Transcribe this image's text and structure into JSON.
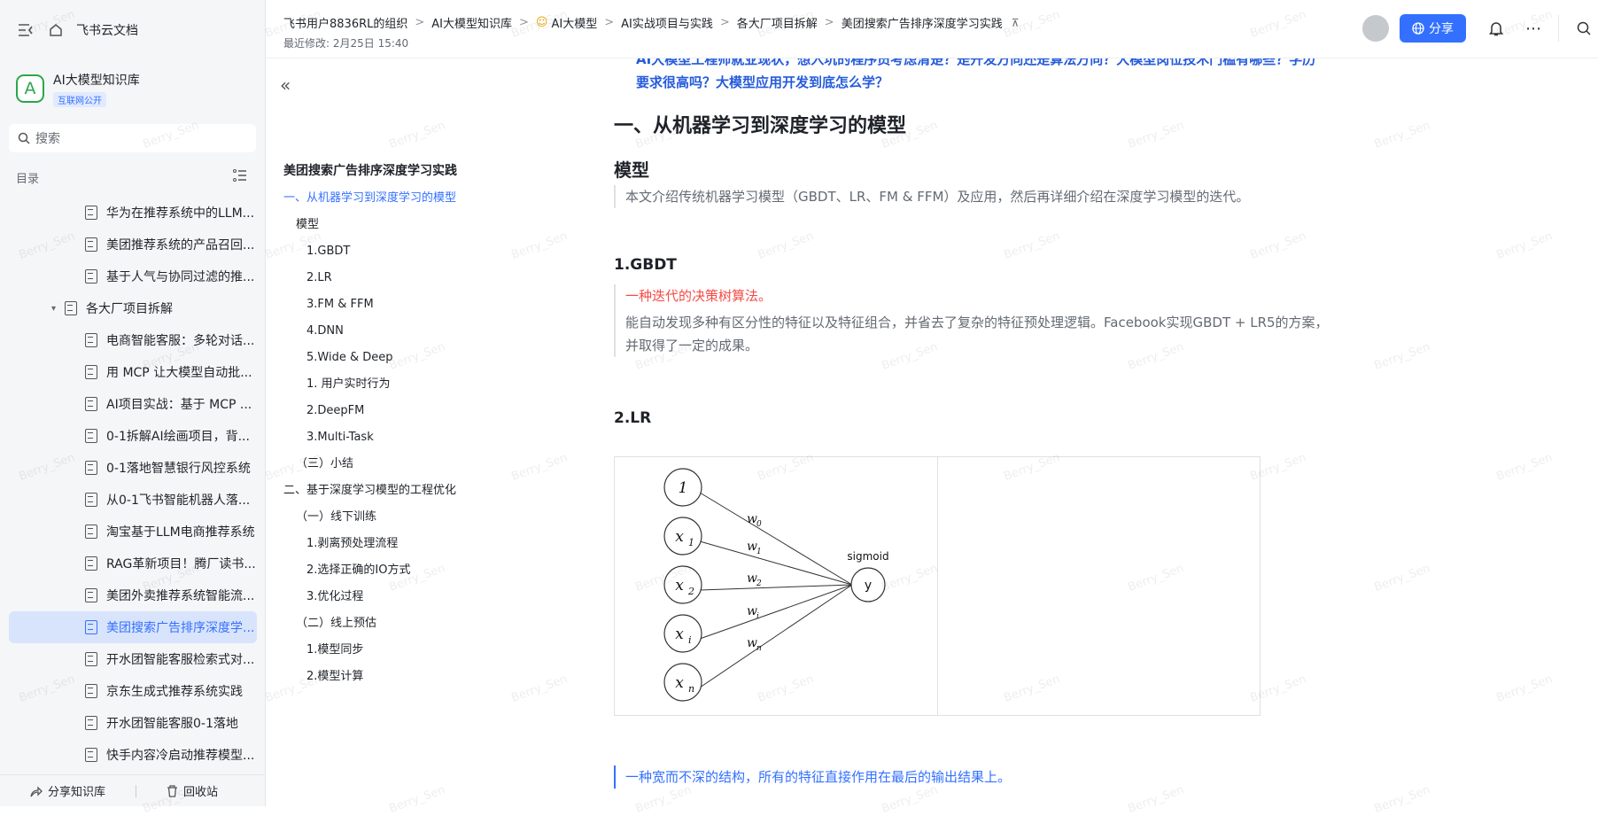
{
  "app": {
    "brand": "飞书云文档"
  },
  "knowledge_base": {
    "logo_letter": "A",
    "name": "AI大模型知识库",
    "badge": "互联网公开"
  },
  "search": {
    "placeholder": "搜索"
  },
  "sidebar_toc_label": "目录",
  "tree": [
    {
      "label": "华为在推荐系统中的LLM...",
      "level": 2
    },
    {
      "label": "美团推荐系统的产品召回...",
      "level": 2
    },
    {
      "label": "基于人气与协同过滤的推...",
      "level": 2
    },
    {
      "label": "各大厂项目拆解",
      "level": 1,
      "expanded": true
    },
    {
      "label": "电商智能客服：多轮对话...",
      "level": 2
    },
    {
      "label": "用 MCP 让大模型自动批...",
      "level": 2
    },
    {
      "label": "AI项目实战：基于 MCP ...",
      "level": 2
    },
    {
      "label": "0-1拆解AI绘画项目，背...",
      "level": 2
    },
    {
      "label": "0-1落地智慧银行风控系统",
      "level": 2
    },
    {
      "label": "从0-1飞书智能机器人落...",
      "level": 2
    },
    {
      "label": "淘宝基于LLM电商推荐系统",
      "level": 2
    },
    {
      "label": "RAG革新项目！腾厂读书...",
      "level": 2
    },
    {
      "label": "美团外卖推荐系统智能流...",
      "level": 2
    },
    {
      "label": "美团搜索广告排序深度学...",
      "level": 2,
      "active": true
    },
    {
      "label": "开水团智能客服检索式对...",
      "level": 2
    },
    {
      "label": "京东生成式推荐系统实践",
      "level": 2
    },
    {
      "label": "开水团智能客服0-1落地",
      "level": 2
    },
    {
      "label": "快手内容冷启动推荐模型...",
      "level": 2
    }
  ],
  "sidebar_bottom": {
    "share_kb": "分享知识库",
    "recycle": "回收站"
  },
  "breadcrumbs": [
    "飞书用户8836RL的组织",
    "AI大模型知识库",
    "AI大模型",
    "AI实战项目与实践",
    "各大厂项目拆解",
    "美团搜索广告排序深度学习实践"
  ],
  "last_modified": "最近修改: 2月25日 15:40",
  "share_button": "分享",
  "outline": {
    "title": "美团搜索广告排序深度学习实践",
    "items": [
      {
        "label": "一、从机器学习到深度学习的模型",
        "indent": 0,
        "active": true
      },
      {
        "label": "模型",
        "indent": 1
      },
      {
        "label": "1.GBDT",
        "indent": 2
      },
      {
        "label": "2.LR",
        "indent": 2
      },
      {
        "label": "3.FM & FFM",
        "indent": 2
      },
      {
        "label": "4.DNN",
        "indent": 2
      },
      {
        "label": "5.Wide & Deep",
        "indent": 2
      },
      {
        "label": "1. 用户实时行为",
        "indent": 2
      },
      {
        "label": "2.DeepFM",
        "indent": 2
      },
      {
        "label": "3.Multi-Task",
        "indent": 2
      },
      {
        "label": "（三）小结",
        "indent": 1
      },
      {
        "label": "二、基于深度学习模型的工程优化",
        "indent": 0
      },
      {
        "label": "（一）线下训练",
        "indent": 1
      },
      {
        "label": "1.剥离预处理流程",
        "indent": 2
      },
      {
        "label": "2.选择正确的IO方式",
        "indent": 2
      },
      {
        "label": "3.优化过程",
        "indent": 2
      },
      {
        "label": "（二）线上预估",
        "indent": 1
      },
      {
        "label": "1.模型同步",
        "indent": 2
      },
      {
        "label": "2.模型计算",
        "indent": 2
      }
    ]
  },
  "content": {
    "top_cut": "AI大模型工程师就业现状，想入坑的程序员考虑清楚？是开发方向还是算法方向？大模型岗位技术门槛有哪些？学历要求很高吗？大模型应用开发到底怎么学？",
    "h1": "一、从机器学习到深度学习的模型",
    "h2": "模型",
    "intro": "本文介绍传统机器学习模型（GBDT、LR、FM & FFM）及应用，然后再详细介绍在深度学习模型的迭代。",
    "gbdt_title": "1.GBDT",
    "gbdt_highlight": "一种迭代的决策树算法。",
    "gbdt_body": "能自动发现多种有区分性的特征以及特征组合，并省去了复杂的特征预处理逻辑。Facebook实现GBDT + LR5的方案，并取得了一定的成果。",
    "lr_title": "2.LR",
    "diagram": {
      "inputs": [
        "1",
        "x",
        "x",
        "x",
        "x"
      ],
      "input_subs": [
        "",
        "1",
        "2",
        "i",
        "n"
      ],
      "weights": [
        "w",
        "w",
        "w",
        "w",
        "w"
      ],
      "weight_subs": [
        "0",
        "1",
        "2",
        "i",
        "n"
      ],
      "activation": "sigmoid",
      "output": "y"
    },
    "wide_highlight": "一种宽而不深的结构，所有的特征直接作用在最后的输出结果上。"
  },
  "watermark": "Berry_Sen",
  "colors": {
    "accent": "#3370ff",
    "highlight_red": "#f54a45",
    "kb_green": "#2aa74a"
  }
}
